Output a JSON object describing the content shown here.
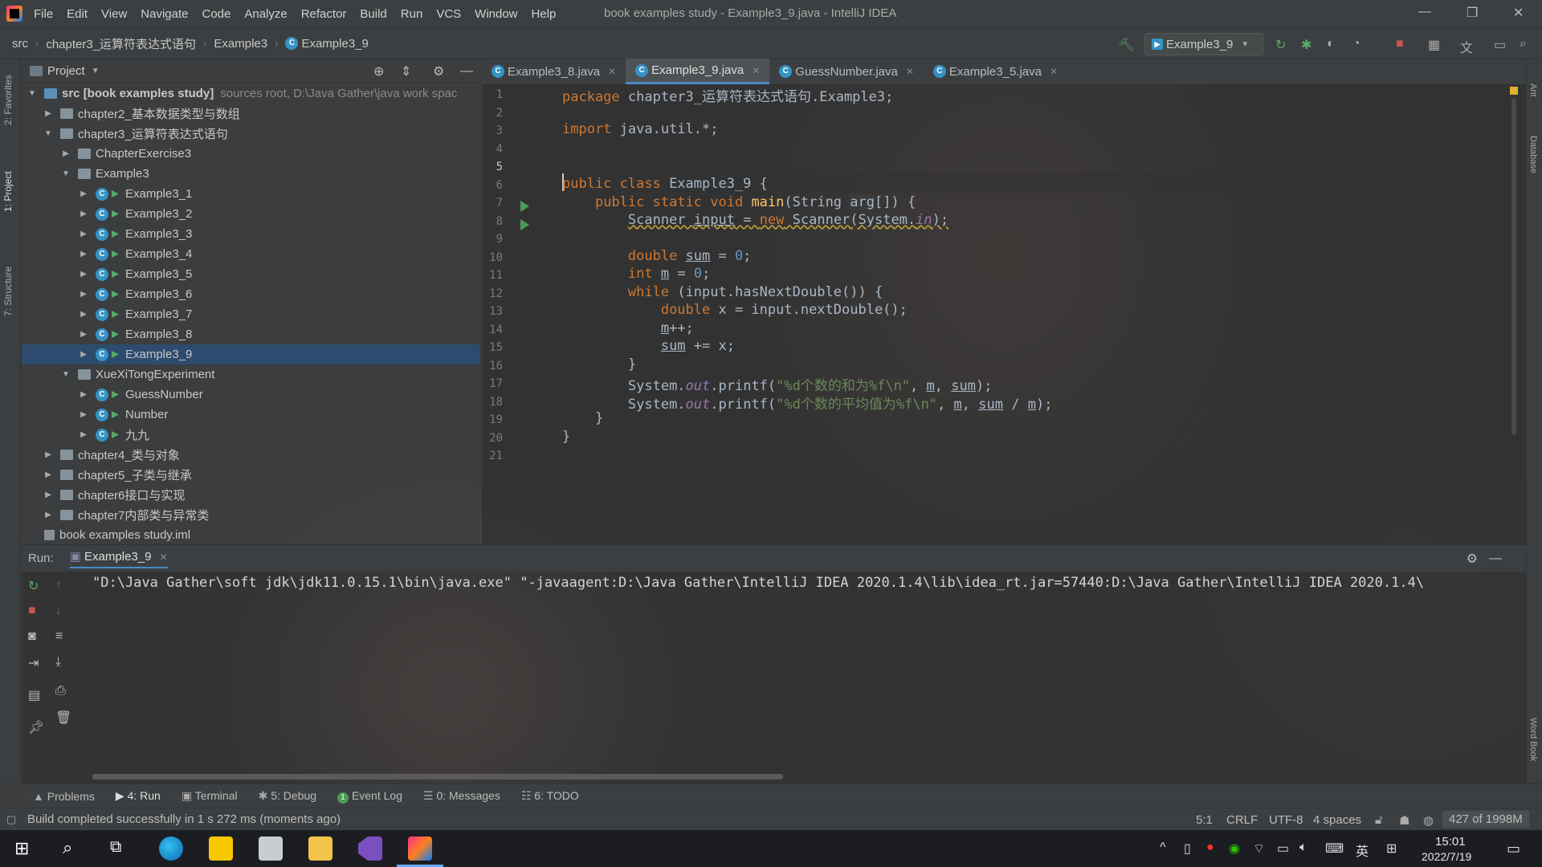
{
  "window": {
    "title": "book examples study - Example3_9.java - IntelliJ IDEA",
    "menu": [
      "File",
      "Edit",
      "View",
      "Navigate",
      "Code",
      "Analyze",
      "Refactor",
      "Build",
      "Run",
      "VCS",
      "Window",
      "Help"
    ]
  },
  "breadcrumb": [
    "src",
    "chapter3_运算符表达式语句",
    "Example3",
    "Example3_9"
  ],
  "run_config": "Example3_9",
  "project": {
    "header": "Project",
    "tree": [
      {
        "label": "src [book examples study]",
        "extra": "sources root,  D:\\Java Gather\\java work spac",
        "type": "src",
        "depth": 0,
        "arrow": "▼"
      },
      {
        "label": "chapter2_基本数据类型与数组",
        "type": "folder",
        "depth": 1,
        "arrow": "▶"
      },
      {
        "label": "chapter3_运算符表达式语句",
        "type": "folder",
        "depth": 1,
        "arrow": "▼"
      },
      {
        "label": "ChapterExercise3",
        "type": "folder",
        "depth": 2,
        "arrow": "▶"
      },
      {
        "label": "Example3",
        "type": "folder",
        "depth": 2,
        "arrow": "▼"
      },
      {
        "label": "Example3_1",
        "type": "class",
        "depth": 3,
        "arrow": "▶"
      },
      {
        "label": "Example3_2",
        "type": "class",
        "depth": 3,
        "arrow": "▶"
      },
      {
        "label": "Example3_3",
        "type": "class",
        "depth": 3,
        "arrow": "▶"
      },
      {
        "label": "Example3_4",
        "type": "class",
        "depth": 3,
        "arrow": "▶"
      },
      {
        "label": "Example3_5",
        "type": "class",
        "depth": 3,
        "arrow": "▶"
      },
      {
        "label": "Example3_6",
        "type": "class",
        "depth": 3,
        "arrow": "▶"
      },
      {
        "label": "Example3_7",
        "type": "class",
        "depth": 3,
        "arrow": "▶"
      },
      {
        "label": "Example3_8",
        "type": "class",
        "depth": 3,
        "arrow": "▶"
      },
      {
        "label": "Example3_9",
        "type": "class",
        "depth": 3,
        "arrow": "▶",
        "selected": true
      },
      {
        "label": "XueXiTongExperiment",
        "type": "folder",
        "depth": 2,
        "arrow": "▼"
      },
      {
        "label": "GuessNumber",
        "type": "class",
        "depth": 3,
        "arrow": "▶"
      },
      {
        "label": "Number",
        "type": "class",
        "depth": 3,
        "arrow": "▶"
      },
      {
        "label": "九九",
        "type": "class",
        "depth": 3,
        "arrow": "▶"
      },
      {
        "label": "chapter4_类与对象",
        "type": "folder",
        "depth": 1,
        "arrow": "▶"
      },
      {
        "label": "chapter5_子类与继承",
        "type": "folder",
        "depth": 1,
        "arrow": "▶"
      },
      {
        "label": "chapter6接口与实现",
        "type": "folder",
        "depth": 1,
        "arrow": "▶"
      },
      {
        "label": "chapter7内部类与异常类",
        "type": "folder",
        "depth": 1,
        "arrow": "▶"
      },
      {
        "label": "book examples study.iml",
        "type": "file",
        "depth": 0,
        "arrow": ""
      }
    ]
  },
  "editor_tabs": [
    {
      "label": "Example3_8.java",
      "active": false
    },
    {
      "label": "Example3_9.java",
      "active": true
    },
    {
      "label": "GuessNumber.java",
      "active": false
    },
    {
      "label": "Example3_5.java",
      "active": false
    }
  ],
  "code": {
    "line_numbers": [
      "1",
      "2",
      "3",
      "4",
      "5",
      "6",
      "7",
      "8",
      "9",
      "10",
      "11",
      "12",
      "13",
      "14",
      "15",
      "16",
      "17",
      "18",
      "19",
      "20",
      "21"
    ],
    "l1_kw": "package",
    "l1_rest": " chapter3_运算符表达式语句.Example3;",
    "l3_kw": "import",
    "l3_rest": " java.util.*;",
    "l6_kw": "public class",
    "l6_rest": " Example3_9 {",
    "l7_kw": "public static void",
    "l7_fn": "main",
    "l7_a": "(String ",
    "l7_arg": "arg",
    "l7_b": "[]) {",
    "l8_a": "Scanner ",
    "l8_var": "input",
    "l8_b": " = ",
    "l8_new": "new",
    "l8_c": " Scanner(System.",
    "l8_in": "in",
    "l8_d": ");",
    "l10_kw": "double",
    "l10_var": "sum",
    "l10_b": " = ",
    "l10_num": "0",
    "l10_c": ";",
    "l11_kw": "int",
    "l11_var": "m",
    "l11_b": " = ",
    "l11_num": "0",
    "l11_c": ";",
    "l12_kw": "while",
    "l12_rest": " (input.hasNextDouble()) {",
    "l13_kw": "double",
    "l13_rest": " x = input.nextDouble();",
    "l14_var": "m",
    "l14_rest": "++;",
    "l15_var": "sum",
    "l15_rest": " += x;",
    "l16": "}",
    "l17_a": "System.",
    "l17_out": "out",
    "l17_b": ".printf(",
    "l17_str": "\"%d个数的和为%f\\n\"",
    "l17_c": ", ",
    "l17_m": "m",
    "l17_d": ", ",
    "l17_sum": "sum",
    "l17_e": ");",
    "l18_a": "System.",
    "l18_out": "out",
    "l18_b": ".printf(",
    "l18_str": "\"%d个数的平均值为%f\\n\"",
    "l18_c": ", ",
    "l18_m": "m",
    "l18_d": ", ",
    "l18_sum": "sum",
    "l18_e": " / ",
    "l18_m2": "m",
    "l18_f": ");",
    "l19": "}",
    "l20": "}"
  },
  "run_panel": {
    "label": "Run:",
    "tab": "Example3_9",
    "console_line": "\"D:\\Java Gather\\soft jdk\\jdk11.0.15.1\\bin\\java.exe\" \"-javaagent:D:\\Java Gather\\IntelliJ IDEA 2020.1.4\\lib\\idea_rt.jar=57440:D:\\Java Gather\\IntelliJ IDEA 2020.1.4\\"
  },
  "left_strip": [
    "2: Favorites",
    "1: Project",
    "7: Structure"
  ],
  "right_strip": [
    "Ant",
    "Database",
    "Word Book"
  ],
  "bottom_tabs": [
    "Problems",
    "4: Run",
    "Terminal",
    "5: Debug",
    "Event Log",
    "0: Messages",
    "6: TODO"
  ],
  "event_log_badge": "1",
  "status": {
    "message": "Build completed successfully in 1 s 272 ms (moments ago)",
    "position": "5:1",
    "line_sep": "CRLF",
    "encoding": "UTF-8",
    "indent": "4 spaces",
    "memory": "427 of 1998M"
  },
  "taskbar": {
    "time": "15:01",
    "date": "2022/7/19",
    "ime": "英"
  },
  "colors": {
    "accent": "#4a88c7",
    "selection": "#2d4b6e",
    "keyword": "#cc7832",
    "string": "#6a8759",
    "number": "#6897bb"
  }
}
